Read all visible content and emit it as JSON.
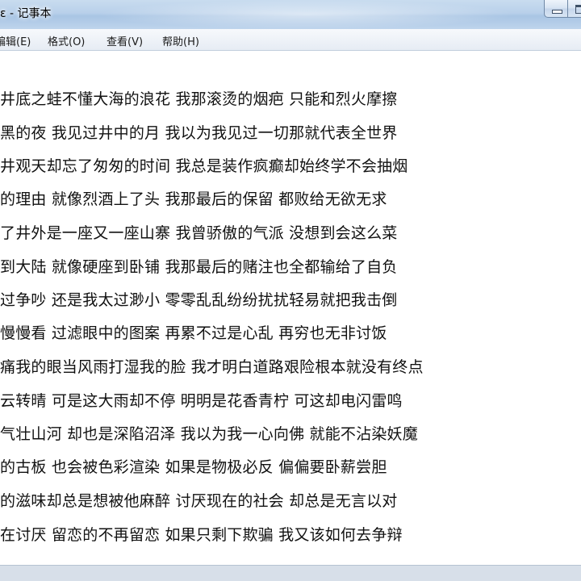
{
  "window": {
    "title": "ɛ - 记事本"
  },
  "menu": [
    {
      "label": "编辑(E)"
    },
    {
      "label": "格式(O)"
    },
    {
      "label": "查看(V)"
    },
    {
      "label": "帮助(H)"
    }
  ],
  "text_lines": [
    "井底之蛙不懂大海的浪花 我那滚烫的烟疤 只能和烈火摩擦",
    "黑的夜 我见过井中的月 我以为我见过一切那就代表全世界",
    "井观天却忘了匆匆的时间 我总是装作疯癫却始终学不会抽烟",
    "的理由 就像烈酒上了头 我那最后的保留 都败给无欲无求",
    "了井外是一座又一座山寨 我曾骄傲的气派 没想到会这么菜",
    "到大陆 就像硬座到卧铺 我那最后的赌注也全都输给了自负",
    "过争吵 还是我太过渺小 零零乱乱纷纷扰扰轻易就把我击倒",
    "慢慢看 过滤眼中的图案 再累不过是心乱 再穷也无非讨饭",
    "痛我的眼当风雨打湿我的脸 我才明白道路艰险根本就没有终点",
    "云转晴 可是这大雨却不停 明明是花香青柠 可这却电闪雷鸣",
    "气壮山河 却也是深陷沼泽 我以为我一心向佛 就能不沾染妖魔",
    "的古板 也会被色彩渲染 如果是物极必反 偏偏要卧薪尝胆",
    "的滋味却总是想被他麻醉 讨厌现在的社会 却总是无言以对",
    "在讨厌 留恋的不再留恋 如果只剩下欺骗 我又该如何去争辩"
  ]
}
